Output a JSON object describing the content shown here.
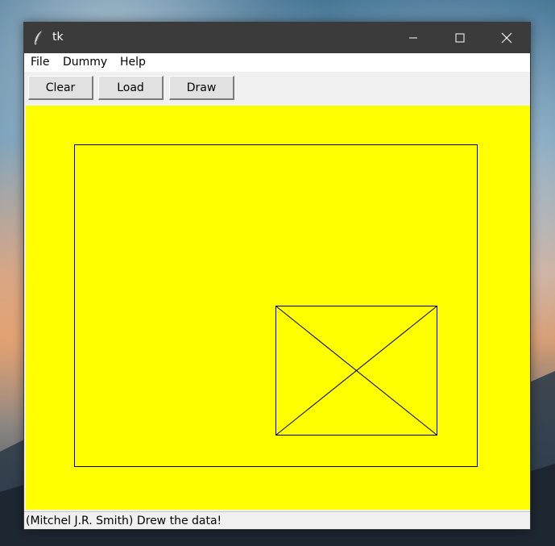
{
  "window": {
    "title": "tk"
  },
  "menubar": {
    "items": [
      {
        "label": "File"
      },
      {
        "label": "Dummy"
      },
      {
        "label": "Help"
      }
    ]
  },
  "toolbar": {
    "clear_label": "Clear",
    "load_label": "Load",
    "draw_label": "Draw"
  },
  "canvas": {
    "background": "#ffff00",
    "stroke": "#000000"
  },
  "statusbar": {
    "text": "(Mitchel J.R. Smith) Drew the data!"
  },
  "colors": {
    "titlebar": "#3b3b3b",
    "canvas": "#ffff00"
  }
}
